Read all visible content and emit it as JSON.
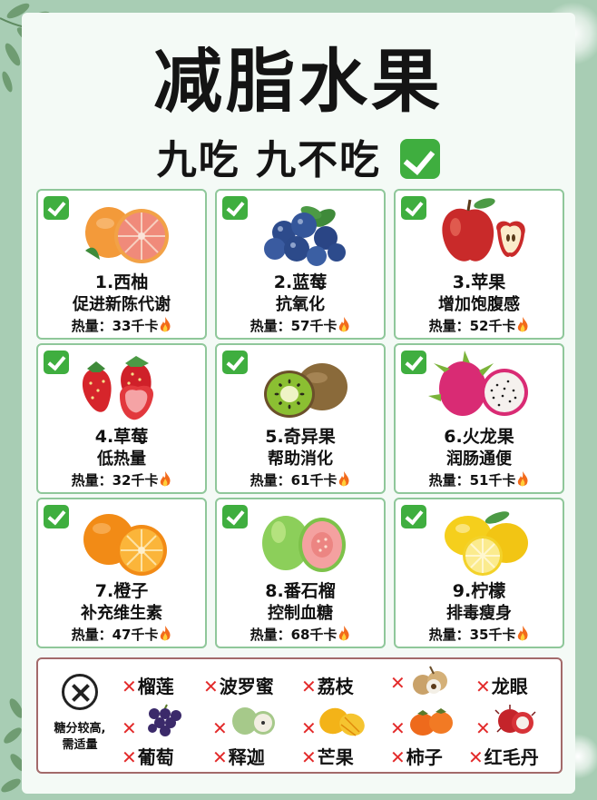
{
  "header": {
    "title": "减脂水果",
    "subtitle": "九吃 九不吃"
  },
  "good_fruits": [
    {
      "name": "1.西柚",
      "benefit": "促进新陈代谢",
      "calories": "热量：33千卡",
      "icon": "grapefruit-icon"
    },
    {
      "name": "2.蓝莓",
      "benefit": "抗氧化",
      "calories": "热量：57千卡",
      "icon": "blueberry-icon"
    },
    {
      "name": "3.苹果",
      "benefit": "增加饱腹感",
      "calories": "热量：52千卡",
      "icon": "apple-icon"
    },
    {
      "name": "4.草莓",
      "benefit": "低热量",
      "calories": "热量：32千卡",
      "icon": "strawberry-icon"
    },
    {
      "name": "5.奇异果",
      "benefit": "帮助消化",
      "calories": "热量：61千卡",
      "icon": "kiwi-icon"
    },
    {
      "name": "6.火龙果",
      "benefit": "润肠通便",
      "calories": "热量：51千卡",
      "icon": "dragonfruit-icon"
    },
    {
      "name": "7.橙子",
      "benefit": "补充维生素",
      "calories": "热量：47千卡",
      "icon": "orange-icon"
    },
    {
      "name": "8.番石榴",
      "benefit": "控制血糖",
      "calories": "热量：68千卡",
      "icon": "guava-icon"
    },
    {
      "name": "9.柠檬",
      "benefit": "排毒瘦身",
      "calories": "热量：35千卡",
      "icon": "lemon-icon"
    }
  ],
  "avoid": {
    "note_line1": "糖分较高,",
    "note_line2": "需适量",
    "items": [
      "榴莲",
      "波罗蜜",
      "荔枝",
      "龙眼",
      "葡萄",
      "释迦",
      "芒果",
      "柿子",
      "红毛丹"
    ]
  },
  "colors": {
    "background": "#a8cdb4",
    "card_border": "#8fc79a",
    "check_green": "#3fae3f",
    "cross_red": "#e32b2b",
    "bottom_border": "#a36a6a"
  }
}
